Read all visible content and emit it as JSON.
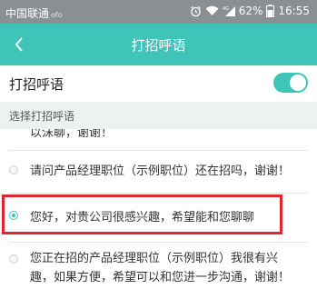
{
  "status_bar": {
    "carrier": "中国联通",
    "carrier_suffix": "ofo",
    "battery": "62%",
    "time": "16:55"
  },
  "nav": {
    "title": "打招呼语",
    "back_icon": "chevron-left-icon"
  },
  "greeting_toggle": {
    "label": "打招呼语",
    "enabled": true
  },
  "section": {
    "header": "选择打招呼语"
  },
  "greetings": [
    {
      "text": "以沫聊，谢谢！",
      "selected": false
    },
    {
      "text": "请问产品经理职位（示例职位）还在招吗，谢谢！",
      "selected": false
    },
    {
      "text": "您好，对贵公司很感兴趣，希望能和您聊聊",
      "selected": true
    },
    {
      "text": "您正在招的产品经理职位（示例职位）我很有兴趣，如果方便，希望可以和您进一步沟通，谢谢！",
      "selected": false
    }
  ],
  "colors": {
    "accent": "#3fc4ba",
    "status_bar": "#8a8f93",
    "highlight": "#e0262f"
  }
}
